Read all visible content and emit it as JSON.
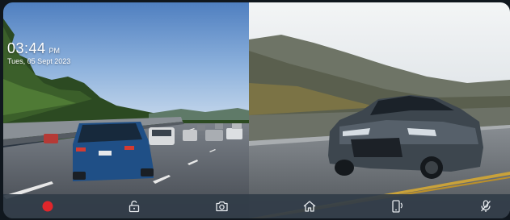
{
  "overlay": {
    "time": "03:44",
    "period": "PM",
    "date": "Tues, 05 Sept 2023"
  },
  "cameras": {
    "rear": "highway traffic, blue SUV ahead",
    "front": "gray sports sedan on mountain road"
  },
  "toolbar": {
    "buttons": [
      {
        "icon": "record-icon",
        "color": "#e0262b"
      },
      {
        "icon": "unlock-icon"
      },
      {
        "icon": "camera-icon"
      },
      {
        "icon": "home-icon"
      },
      {
        "icon": "phone-rotate-icon"
      },
      {
        "icon": "mic-mute-icon"
      }
    ],
    "icon_color": "#e6eaee"
  }
}
